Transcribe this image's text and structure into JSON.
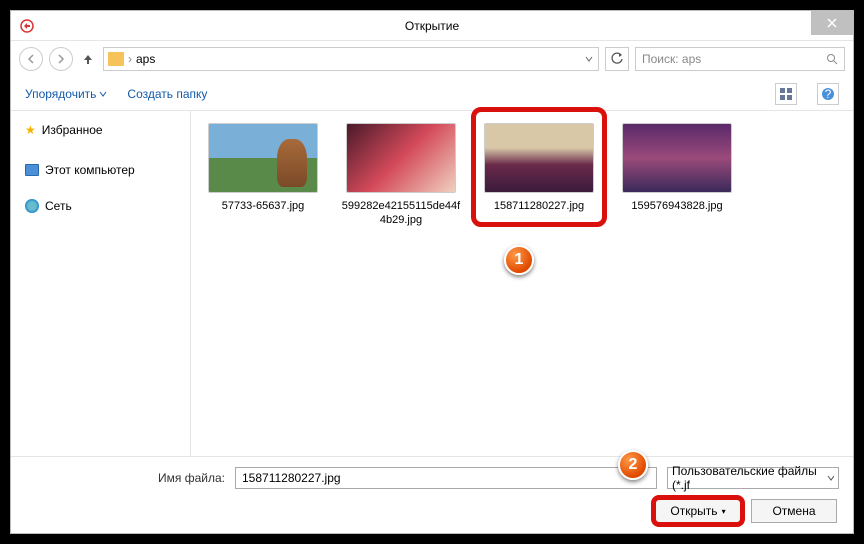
{
  "title": "Открытие",
  "path": {
    "folder": "aps",
    "sep": "›"
  },
  "search": {
    "placeholder": "Поиск: aps"
  },
  "toolbar": {
    "organize": "Упорядочить",
    "new_folder": "Создать папку"
  },
  "sidebar": {
    "favorites": "Избранное",
    "this_pc": "Этот компьютер",
    "network": "Сеть"
  },
  "files": [
    {
      "name": "57733-65637.jpg"
    },
    {
      "name": "599282e42155115de44f4b29.jpg"
    },
    {
      "name": "158711280227.jpg"
    },
    {
      "name": "159576943828.jpg"
    }
  ],
  "footer": {
    "filename_label": "Имя файла:",
    "filename_value": "158711280227.jpg",
    "filter": "Пользовательские файлы (*.jf",
    "open": "Открыть",
    "cancel": "Отмена"
  },
  "callouts": {
    "one": "1",
    "two": "2"
  }
}
